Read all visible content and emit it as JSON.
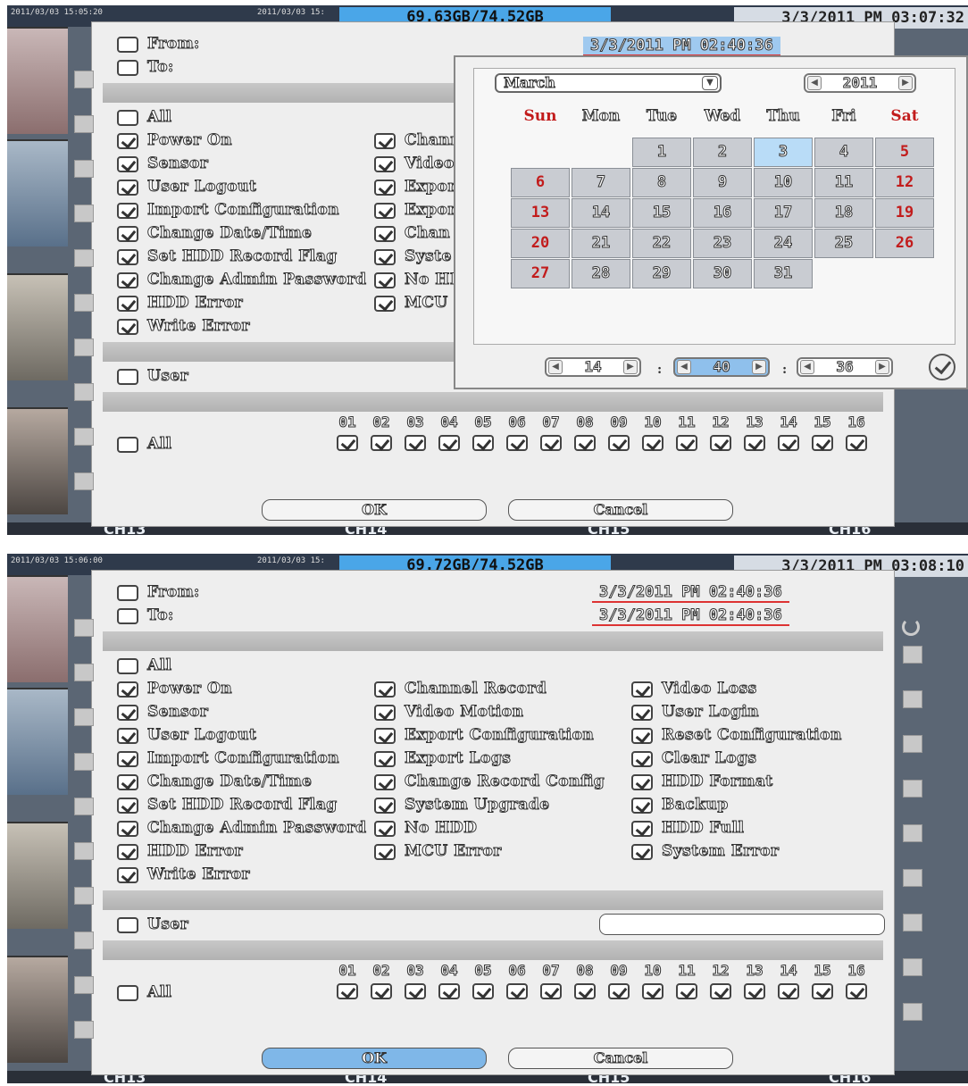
{
  "top": {
    "hdd_usage": "69.63GB/74.52GB",
    "clock": "3/3/2011 PM 03:07:32",
    "strip_left": "2011/03/03  15:05:20",
    "strip_mid": "2011/03/03  15:",
    "channels": [
      "CH13",
      "CH14",
      "CH15",
      "CH16"
    ],
    "from_label": "From:",
    "to_label": "To:",
    "from_value": "3/3/2011 PM 02:40:36",
    "all_label": "All",
    "events_col1": [
      "Power On",
      "Sensor",
      "User Logout",
      "Import Configuration",
      "Change Date/Time",
      "Set HDD Record Flag",
      "Change Admin Password",
      "HDD Error",
      "Write Error"
    ],
    "events_col2_partial": [
      "Chann",
      "Video",
      "Expor",
      "Expor",
      "Chan",
      "Syste",
      "No HI",
      "MCU"
    ],
    "user_label": "User",
    "ch_all_label": "All",
    "ch_numbers": [
      "01",
      "02",
      "03",
      "04",
      "05",
      "06",
      "07",
      "08",
      "09",
      "10",
      "11",
      "12",
      "13",
      "14",
      "15",
      "16"
    ],
    "ok_label": "OK",
    "cancel_label": "Cancel",
    "calendar": {
      "month": "March",
      "year": "2011",
      "weekdays": [
        "Sun",
        "Mon",
        "Tue",
        "Wed",
        "Thu",
        "Fri",
        "Sat"
      ],
      "days": [
        "1",
        "2",
        "3",
        "4",
        "5",
        "6",
        "7",
        "8",
        "9",
        "10",
        "11",
        "12",
        "13",
        "14",
        "15",
        "16",
        "17",
        "18",
        "19",
        "20",
        "21",
        "22",
        "23",
        "24",
        "25",
        "26",
        "27",
        "28",
        "29",
        "30",
        "31"
      ],
      "selected_day": "3",
      "hour": "14",
      "minute": "40",
      "second": "36"
    }
  },
  "bottom": {
    "hdd_usage": "69.72GB/74.52GB",
    "clock": "3/3/2011 PM 03:08:10",
    "strip_left": "2011/03/03  15:06:00",
    "strip_mid": "2011/03/03  15:",
    "channels": [
      "CH13",
      "CH14",
      "CH15",
      "CH16"
    ],
    "from_label": "From:",
    "to_label": "To:",
    "from_value": "3/3/2011 PM 02:40:36",
    "to_value": "3/3/2011 PM 02:40:36",
    "all_label": "All",
    "events_col1": [
      "Power On",
      "Sensor",
      "User Logout",
      "Import Configuration",
      "Change Date/Time",
      "Set HDD Record Flag",
      "Change Admin Password",
      "HDD Error",
      "Write Error"
    ],
    "events_col2": [
      "Channel Record",
      "Video Motion",
      "Export Configuration",
      "Export Logs",
      "Change Record Config",
      "System Upgrade",
      "No HDD",
      "MCU Error"
    ],
    "events_col3": [
      "Video Loss",
      "User Login",
      "Reset Configuration",
      "Clear Logs",
      "HDD Format",
      "Backup",
      "HDD Full",
      "System Error"
    ],
    "user_label": "User",
    "user_value": "",
    "ch_all_label": "All",
    "ch_numbers": [
      "01",
      "02",
      "03",
      "04",
      "05",
      "06",
      "07",
      "08",
      "09",
      "10",
      "11",
      "12",
      "13",
      "14",
      "15",
      "16"
    ],
    "ok_label": "OK",
    "cancel_label": "Cancel"
  }
}
